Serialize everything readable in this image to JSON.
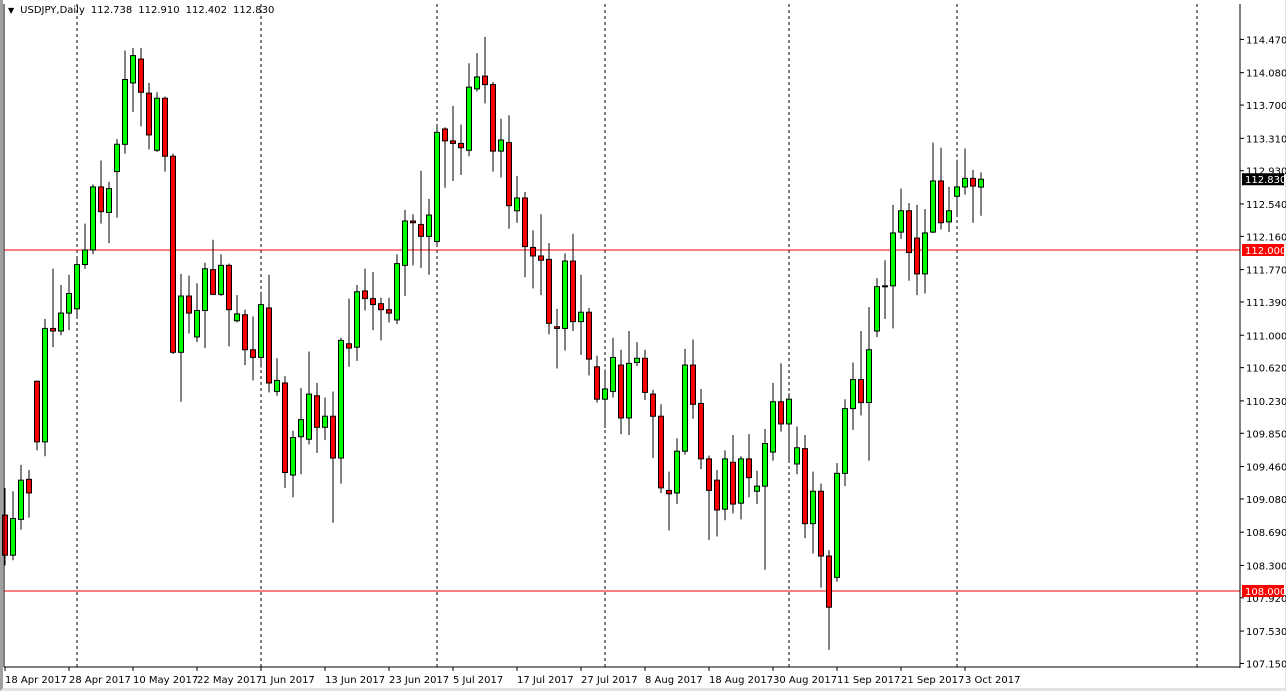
{
  "header": {
    "symbol": "USDJPY,Daily",
    "open": "112.738",
    "high": "112.910",
    "low": "112.402",
    "close": "112.830"
  },
  "chart_data": {
    "type": "candlestick",
    "title": "USDJPY,Daily",
    "ylim": [
      107.15,
      114.47
    ],
    "y_ticks": [
      "114.470",
      "114.080",
      "113.700",
      "113.310",
      "112.930",
      "112.540",
      "112.160",
      "111.770",
      "111.390",
      "111.000",
      "110.620",
      "110.230",
      "109.850",
      "109.460",
      "109.080",
      "108.690",
      "108.300",
      "107.920",
      "107.530",
      "107.150"
    ],
    "x_tick_labels": [
      "18 Apr 2017",
      "28 Apr 2017",
      "10 May 2017",
      "22 May 2017",
      "1 Jun 2017",
      "13 Jun 2017",
      "23 Jun 2017",
      "5 Jul 2017",
      "17 Jul 2017",
      "27 Jul 2017",
      "8 Aug 2017",
      "18 Aug 2017",
      "30 Aug 2017",
      "11 Sep 2017",
      "21 Sep 2017",
      "3 Oct 2017"
    ],
    "x_tick_every_bars": 8,
    "period_separator_bars": [
      9,
      32,
      54,
      75,
      98,
      119,
      149
    ],
    "horizontal_lines": [
      {
        "price": 112.0,
        "label": "112.000",
        "color": "#ff0000"
      },
      {
        "price": 108.0,
        "label": "108.000",
        "color": "#ff0000"
      }
    ],
    "current_price": {
      "price": 112.83,
      "label": "112.830"
    },
    "colors": {
      "bull": "#00ff00",
      "bear": "#ff0000",
      "outline": "#000000"
    },
    "ohlc": [
      [
        108.89,
        109.21,
        108.3,
        108.42
      ],
      [
        108.42,
        109.17,
        108.36,
        108.85
      ],
      [
        108.84,
        109.48,
        108.72,
        109.3
      ],
      [
        109.31,
        109.42,
        108.86,
        109.15
      ],
      [
        110.46,
        110.47,
        109.65,
        109.75
      ],
      [
        109.75,
        111.19,
        109.58,
        111.08
      ],
      [
        111.08,
        111.78,
        110.86,
        111.05
      ],
      [
        111.05,
        111.59,
        111.0,
        111.26
      ],
      [
        111.26,
        111.71,
        111.06,
        111.49
      ],
      [
        111.31,
        111.93,
        111.21,
        111.83
      ],
      [
        111.83,
        112.31,
        111.78,
        112.0
      ],
      [
        112.0,
        112.77,
        111.95,
        112.74
      ],
      [
        112.74,
        113.05,
        112.31,
        112.45
      ],
      [
        112.44,
        112.8,
        112.08,
        112.72
      ],
      [
        112.92,
        113.3,
        112.38,
        113.24
      ],
      [
        113.24,
        114.34,
        113.13,
        114.0
      ],
      [
        113.96,
        114.37,
        113.62,
        114.28
      ],
      [
        114.24,
        114.37,
        113.45,
        113.85
      ],
      [
        113.84,
        113.96,
        113.18,
        113.35
      ],
      [
        113.17,
        113.85,
        113.15,
        113.78
      ],
      [
        113.78,
        113.8,
        112.92,
        113.1
      ],
      [
        113.1,
        113.13,
        110.78,
        110.8
      ],
      [
        110.8,
        111.72,
        110.22,
        111.46
      ],
      [
        111.46,
        111.7,
        111.02,
        111.26
      ],
      [
        110.98,
        111.61,
        110.92,
        111.29
      ],
      [
        111.29,
        111.85,
        110.85,
        111.78
      ],
      [
        111.77,
        112.12,
        111.47,
        111.48
      ],
      [
        111.48,
        111.95,
        111.46,
        111.82
      ],
      [
        111.82,
        111.84,
        110.87,
        111.3
      ],
      [
        111.17,
        111.47,
        111.15,
        111.25
      ],
      [
        111.24,
        111.3,
        110.65,
        110.83
      ],
      [
        110.83,
        111.22,
        110.47,
        110.74
      ],
      [
        110.74,
        111.51,
        110.62,
        111.36
      ],
      [
        111.32,
        111.71,
        110.33,
        110.44
      ],
      [
        110.34,
        110.73,
        110.29,
        110.47
      ],
      [
        110.44,
        110.52,
        109.21,
        109.39
      ],
      [
        109.36,
        109.88,
        109.1,
        109.8
      ],
      [
        109.81,
        110.38,
        109.37,
        110.01
      ],
      [
        109.78,
        110.81,
        109.72,
        110.31
      ],
      [
        110.29,
        110.44,
        109.62,
        109.92
      ],
      [
        109.92,
        110.27,
        109.77,
        110.05
      ],
      [
        110.05,
        110.34,
        108.8,
        109.56
      ],
      [
        109.56,
        110.97,
        109.26,
        110.94
      ],
      [
        110.9,
        111.43,
        110.63,
        110.85
      ],
      [
        110.86,
        111.59,
        110.7,
        111.51
      ],
      [
        111.52,
        111.78,
        111.29,
        111.43
      ],
      [
        111.43,
        111.74,
        111.06,
        111.36
      ],
      [
        111.37,
        111.44,
        110.94,
        111.3
      ],
      [
        111.3,
        111.44,
        111.15,
        111.26
      ],
      [
        111.18,
        111.95,
        111.13,
        111.84
      ],
      [
        111.82,
        112.47,
        111.46,
        112.34
      ],
      [
        112.34,
        112.42,
        111.82,
        112.32
      ],
      [
        112.3,
        112.93,
        111.79,
        112.16
      ],
      [
        112.16,
        112.6,
        111.71,
        112.41
      ],
      [
        112.1,
        113.47,
        112.05,
        113.38
      ],
      [
        113.42,
        113.44,
        112.73,
        113.28
      ],
      [
        113.28,
        113.69,
        112.81,
        113.25
      ],
      [
        113.25,
        113.47,
        112.88,
        113.2
      ],
      [
        113.17,
        114.19,
        113.1,
        113.91
      ],
      [
        113.89,
        114.31,
        113.86,
        114.03
      ],
      [
        114.04,
        114.5,
        113.72,
        113.94
      ],
      [
        113.94,
        113.97,
        112.92,
        113.16
      ],
      [
        113.16,
        113.54,
        112.85,
        113.29
      ],
      [
        113.26,
        113.58,
        112.25,
        112.52
      ],
      [
        112.46,
        112.87,
        112.32,
        112.61
      ],
      [
        112.61,
        112.68,
        111.68,
        112.04
      ],
      [
        112.03,
        112.23,
        111.55,
        111.93
      ],
      [
        111.93,
        112.42,
        111.47,
        111.88
      ],
      [
        111.89,
        112.08,
        111.01,
        111.14
      ],
      [
        111.1,
        111.31,
        110.61,
        111.08
      ],
      [
        111.08,
        111.96,
        110.82,
        111.87
      ],
      [
        111.87,
        112.19,
        111.05,
        111.16
      ],
      [
        111.16,
        111.71,
        110.77,
        111.27
      ],
      [
        111.27,
        111.32,
        110.53,
        110.72
      ],
      [
        110.63,
        110.76,
        110.21,
        110.25
      ],
      [
        110.25,
        110.6,
        109.91,
        110.37
      ],
      [
        110.34,
        110.97,
        110.27,
        110.74
      ],
      [
        110.65,
        110.83,
        109.84,
        110.03
      ],
      [
        110.03,
        111.05,
        109.83,
        110.67
      ],
      [
        110.68,
        110.92,
        110.64,
        110.73
      ],
      [
        110.73,
        110.83,
        110.24,
        110.33
      ],
      [
        110.31,
        110.36,
        109.56,
        110.05
      ],
      [
        110.05,
        110.19,
        109.15,
        109.21
      ],
      [
        109.18,
        109.4,
        108.71,
        109.14
      ],
      [
        109.15,
        109.79,
        109.02,
        109.64
      ],
      [
        109.64,
        110.84,
        109.6,
        110.65
      ],
      [
        110.65,
        110.95,
        110.02,
        110.19
      ],
      [
        110.2,
        110.37,
        109.43,
        109.55
      ],
      [
        109.55,
        109.59,
        108.6,
        109.18
      ],
      [
        109.3,
        109.42,
        108.64,
        108.95
      ],
      [
        108.96,
        109.65,
        108.83,
        109.55
      ],
      [
        109.51,
        109.83,
        108.91,
        109.02
      ],
      [
        109.03,
        109.58,
        108.84,
        109.55
      ],
      [
        109.55,
        109.84,
        109.1,
        109.33
      ],
      [
        109.17,
        109.41,
        109.02,
        109.23
      ],
      [
        109.23,
        109.9,
        108.25,
        109.73
      ],
      [
        109.63,
        110.44,
        109.53,
        110.22
      ],
      [
        110.22,
        110.67,
        109.87,
        109.96
      ],
      [
        109.96,
        110.32,
        109.52,
        110.25
      ],
      [
        109.49,
        109.93,
        109.37,
        109.68
      ],
      [
        109.67,
        109.83,
        108.62,
        108.79
      ],
      [
        108.79,
        109.4,
        108.44,
        109.17
      ],
      [
        109.17,
        109.26,
        108.04,
        108.41
      ],
      [
        108.41,
        108.48,
        107.31,
        107.81
      ],
      [
        108.16,
        109.5,
        108.11,
        109.38
      ],
      [
        109.38,
        110.25,
        109.23,
        110.14
      ],
      [
        110.14,
        110.68,
        109.89,
        110.48
      ],
      [
        110.48,
        111.05,
        110.06,
        110.21
      ],
      [
        110.21,
        111.33,
        109.53,
        110.83
      ],
      [
        111.05,
        111.67,
        110.98,
        111.57
      ],
      [
        111.57,
        111.88,
        111.19,
        111.58
      ],
      [
        111.58,
        112.53,
        111.08,
        112.2
      ],
      [
        112.21,
        112.72,
        112.13,
        112.46
      ],
      [
        112.46,
        112.55,
        111.64,
        111.97
      ],
      [
        112.14,
        112.53,
        111.47,
        111.72
      ],
      [
        111.72,
        112.48,
        111.49,
        112.2
      ],
      [
        112.21,
        113.26,
        112.2,
        112.81
      ],
      [
        112.81,
        113.2,
        112.24,
        112.32
      ],
      [
        112.33,
        112.74,
        112.21,
        112.46
      ],
      [
        112.63,
        113.06,
        112.4,
        112.74
      ],
      [
        112.74,
        113.19,
        112.65,
        112.84
      ],
      [
        112.84,
        112.94,
        112.32,
        112.75
      ],
      [
        112.738,
        112.91,
        112.402,
        112.83
      ]
    ]
  }
}
